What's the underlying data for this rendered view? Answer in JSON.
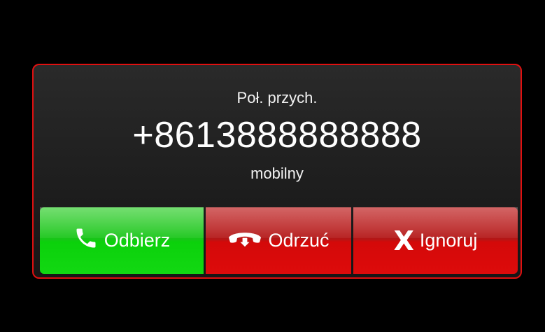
{
  "call": {
    "caption": "Poł. przych.",
    "number": "+8613888888888",
    "number_type": "mobilny"
  },
  "actions": {
    "answer_label": "Odbierz",
    "reject_label": "Odrzuć",
    "ignore_label": "Ignoruj",
    "ignore_icon_glyph": "X"
  },
  "icons": {
    "answer": "phone-handset-icon",
    "reject": "hang-up-icon",
    "ignore": "x-icon"
  },
  "colors": {
    "frame_border": "#e01010",
    "answer": "#12d812",
    "reject": "#dd0b0b",
    "ignore": "#dd0b0b"
  }
}
